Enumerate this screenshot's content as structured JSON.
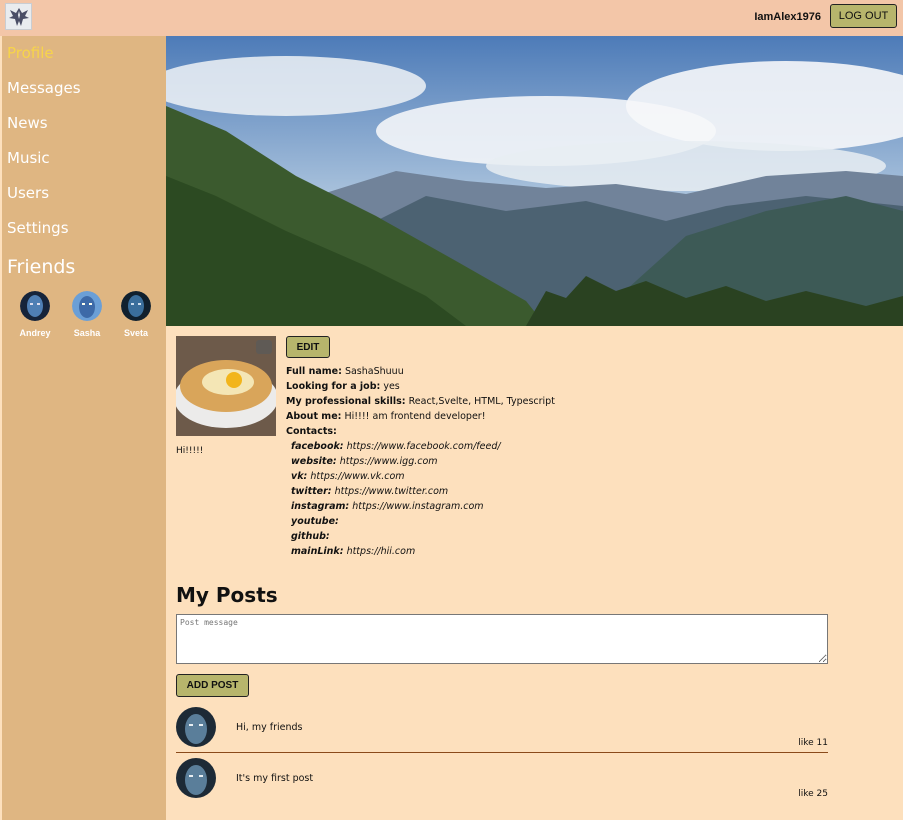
{
  "header": {
    "logo_icon": "phoenix-logo-icon",
    "username": "IamAlex1976",
    "logout_label": "LOG OUT"
  },
  "sidebar": {
    "items": [
      {
        "label": "Profile",
        "active": true
      },
      {
        "label": "Messages"
      },
      {
        "label": "News"
      },
      {
        "label": "Music"
      },
      {
        "label": "Users"
      },
      {
        "label": "Settings"
      }
    ],
    "friends_title": "Friends",
    "friends": [
      {
        "name": "Andrey"
      },
      {
        "name": "Sasha"
      },
      {
        "name": "Sveta"
      }
    ]
  },
  "profile": {
    "edit_label": "EDIT",
    "status": "Hi!!!!!",
    "full_name_label": "Full name:",
    "full_name": "SashaShuuu",
    "job_label": "Looking for a job:",
    "job": "yes",
    "skills_label": "My professional skills:",
    "skills": "React,Svelte, HTML, Typescript",
    "about_label": "About me:",
    "about": "Hi!!!! am frontend developer!",
    "contacts_label": "Contacts:",
    "contacts": [
      {
        "label": "facebook:",
        "value": "https://www.facebook.com/feed/"
      },
      {
        "label": "website:",
        "value": "https://www.igg.com"
      },
      {
        "label": "vk:",
        "value": "https://www.vk.com"
      },
      {
        "label": "twitter:",
        "value": "https://www.twitter.com"
      },
      {
        "label": "instagram:",
        "value": "https://www.instagram.com"
      },
      {
        "label": "youtube:",
        "value": ""
      },
      {
        "label": "github:",
        "value": ""
      },
      {
        "label": "mainLink:",
        "value": "https://hii.com"
      }
    ]
  },
  "posts": {
    "title": "My Posts",
    "placeholder": "Post message",
    "add_label": "ADD POST",
    "items": [
      {
        "text": "Hi, my friends",
        "likes": "like 11"
      },
      {
        "text": "It's my first post",
        "likes": "like 25"
      }
    ]
  },
  "colors": {
    "header_bg": "#f3c6a8",
    "sidebar_bg": "#dfb682",
    "content_bg": "#fde0bd",
    "button_bg": "#b7b56c",
    "active_nav": "#f7d44a"
  }
}
